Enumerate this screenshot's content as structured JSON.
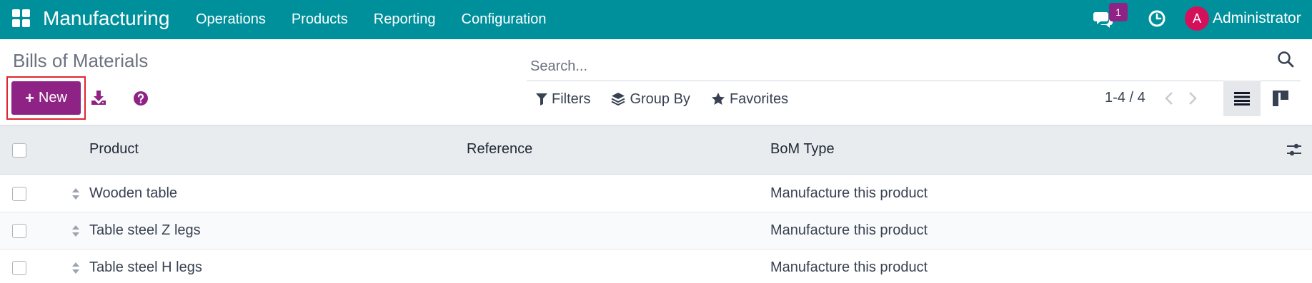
{
  "navbar": {
    "app_title": "Manufacturing",
    "menu": [
      "Operations",
      "Products",
      "Reporting",
      "Configuration"
    ],
    "chat_badge": "1",
    "avatar_initial": "A",
    "user_name": "Administrator",
    "bg_color": "#00909c"
  },
  "control_panel": {
    "page_title": "Bills of Materials",
    "new_label": "New",
    "search_placeholder": "Search...",
    "filters_label": "Filters",
    "group_by_label": "Group By",
    "favorites_label": "Favorites",
    "pager": "1-4 / 4",
    "accent_color": "#8e2385"
  },
  "table": {
    "columns": [
      "Product",
      "Reference",
      "BoM Type"
    ],
    "rows": [
      {
        "product": "Wooden table",
        "reference": "",
        "bom_type": "Manufacture this product"
      },
      {
        "product": "Table steel Z legs",
        "reference": "",
        "bom_type": "Manufacture this product"
      },
      {
        "product": "Table steel H legs",
        "reference": "",
        "bom_type": "Manufacture this product"
      }
    ]
  }
}
